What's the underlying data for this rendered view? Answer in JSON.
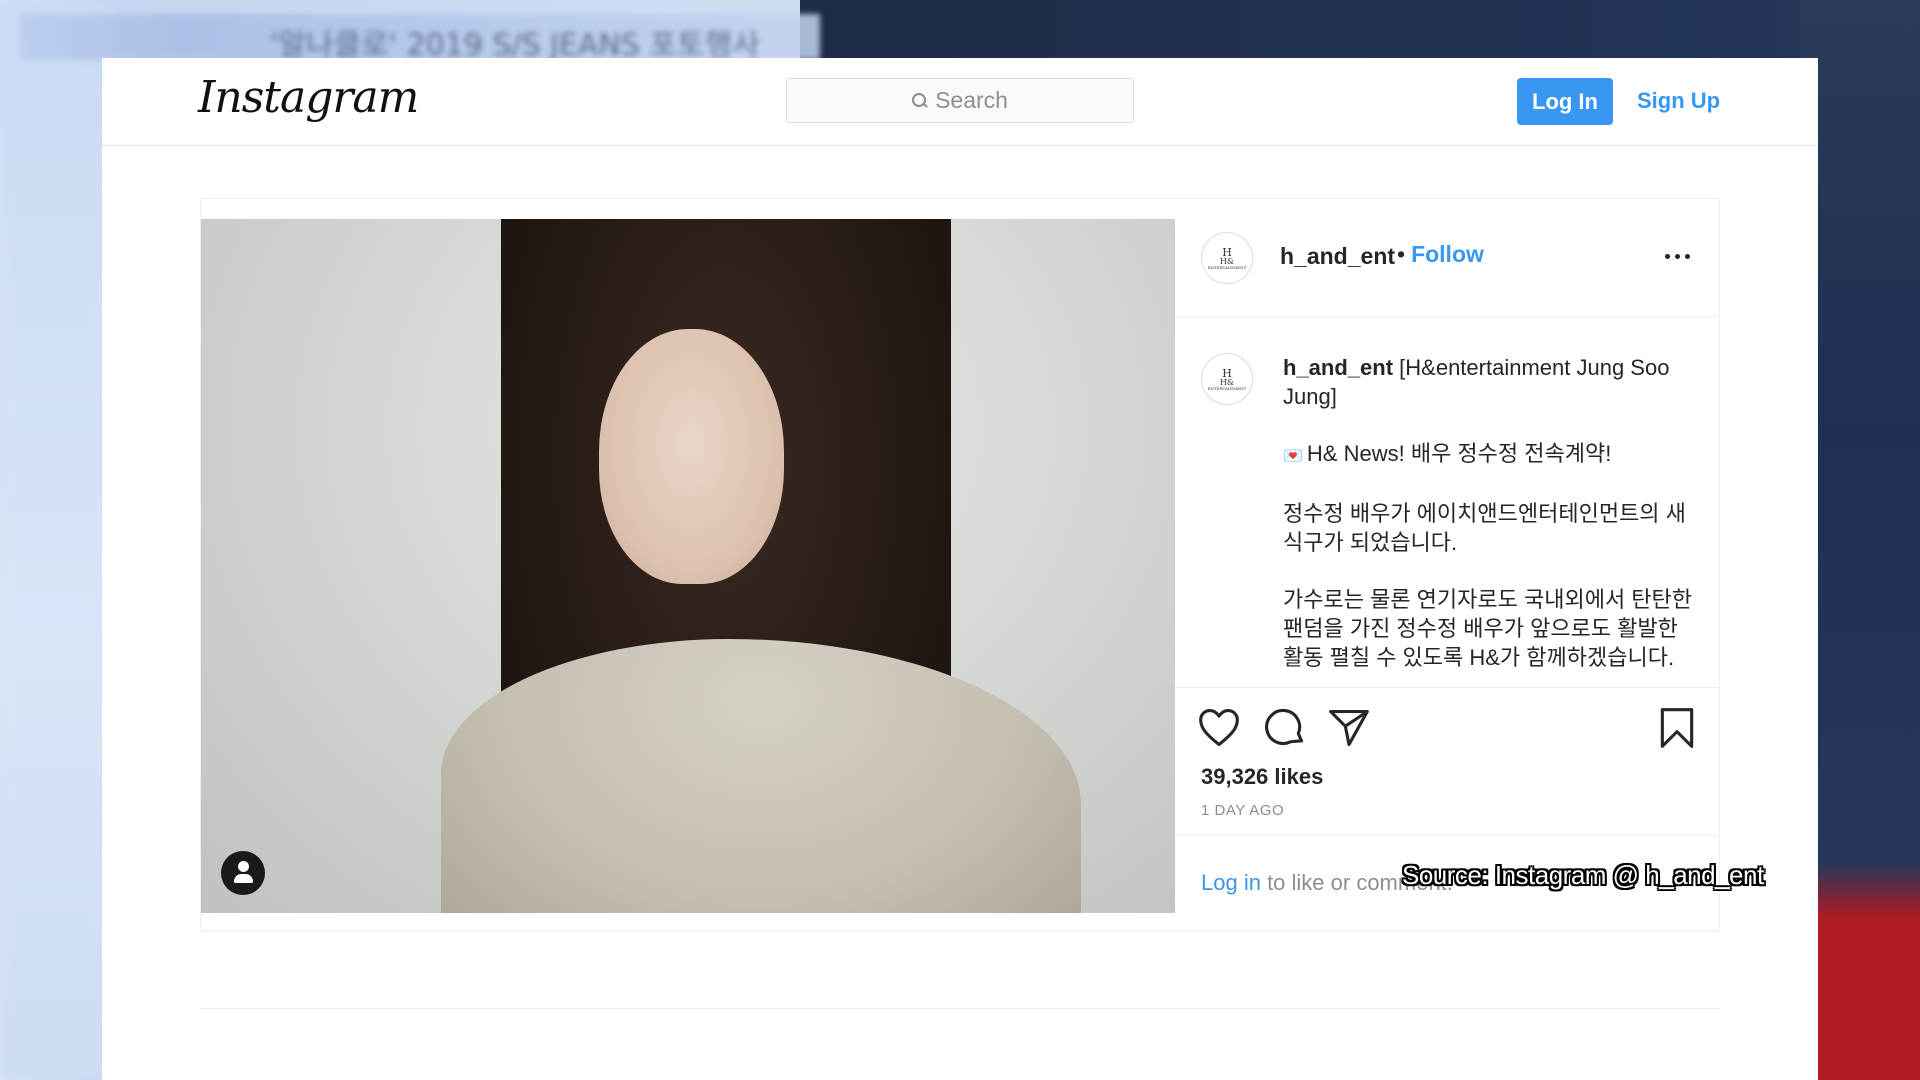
{
  "background": {
    "top_bar_text": "'알나클로' 2019 S/S JEANS 포토행사"
  },
  "header": {
    "logo": "Instagram",
    "search_placeholder": "Search",
    "login_label": "Log In",
    "signup_label": "Sign Up"
  },
  "post": {
    "username": "h_and_ent",
    "bullet": "•",
    "follow_label": "Follow",
    "avatar_mark": "H",
    "avatar_text": "H&",
    "avatar_subtext": "ENTERTAINMENT",
    "caption": {
      "username": "h_and_ent",
      "title": "[H&entertainment Jung Soo Jung]",
      "line_news": "H& News! 배우 정수정 전속계약!",
      "line_2": "정수정 배우가 에이치앤드엔터테인먼트의 새 식구가 되었습니다.",
      "line_3": "가수로는 물론 연기자로도 국내외에서 탄탄한 팬덤을 가진 정수정 배우가 앞으로도 활발한 활동 펼칠 수 있도록 H&가 함께하겠습니다."
    },
    "likes": "39,326 likes",
    "time_ago": "1 DAY AGO",
    "login_link": "Log in",
    "login_suffix": " to like or comment."
  },
  "overlay": {
    "source": "Source: Instagram @ h_and_ent"
  },
  "colors": {
    "accent": "#3897f0",
    "text": "#262626",
    "muted": "#8e8e8e"
  }
}
